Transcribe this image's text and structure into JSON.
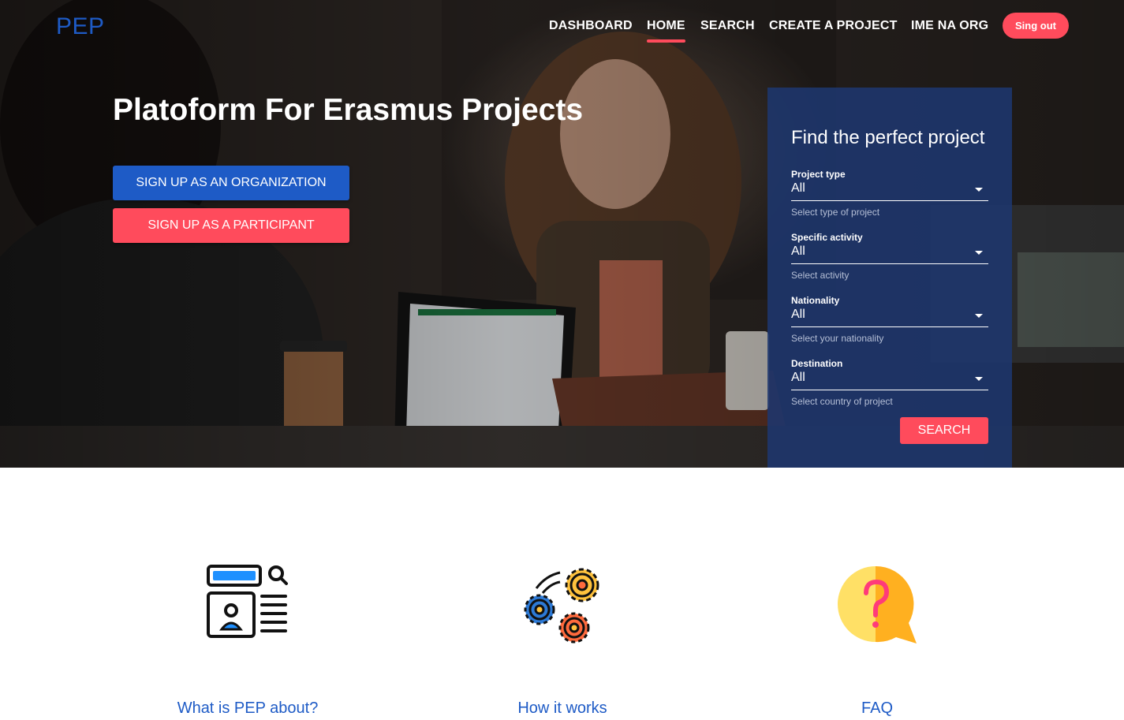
{
  "brand": {
    "logo": "PEP"
  },
  "nav": {
    "items": [
      {
        "label": "DASHBOARD",
        "active": false
      },
      {
        "label": "HOME",
        "active": true
      },
      {
        "label": "SEARCH",
        "active": false
      },
      {
        "label": "CREATE A PROJECT",
        "active": false
      },
      {
        "label": "IME NA ORG",
        "active": false
      }
    ],
    "signout_label": "Sing out"
  },
  "hero": {
    "title": "Platoform For Erasmus Projects",
    "signup_org_label": "SIGN UP AS AN ORGANIZATION",
    "signup_participant_label": "SIGN UP AS A PARTICIPANT"
  },
  "search_panel": {
    "title": "Find the perfect project",
    "fields": [
      {
        "label": "Project type",
        "value": "All",
        "help": "Select type of project"
      },
      {
        "label": "Specific activity",
        "value": "All",
        "help": "Select activity"
      },
      {
        "label": "Nationality",
        "value": "All",
        "help": "Select your nationality"
      },
      {
        "label": "Destination",
        "value": "All",
        "help": "Select country of project"
      }
    ],
    "search_label": "SEARCH"
  },
  "features": [
    {
      "label": "What is PEP about?",
      "icon": "profile-document-icon"
    },
    {
      "label": "How it works",
      "icon": "gears-icon"
    },
    {
      "label": "FAQ",
      "icon": "question-bubble-icon"
    }
  ],
  "colors": {
    "brand_blue": "#1e5bc6",
    "accent_red": "#ff4b5c",
    "panel_bg": "#1e376e"
  }
}
